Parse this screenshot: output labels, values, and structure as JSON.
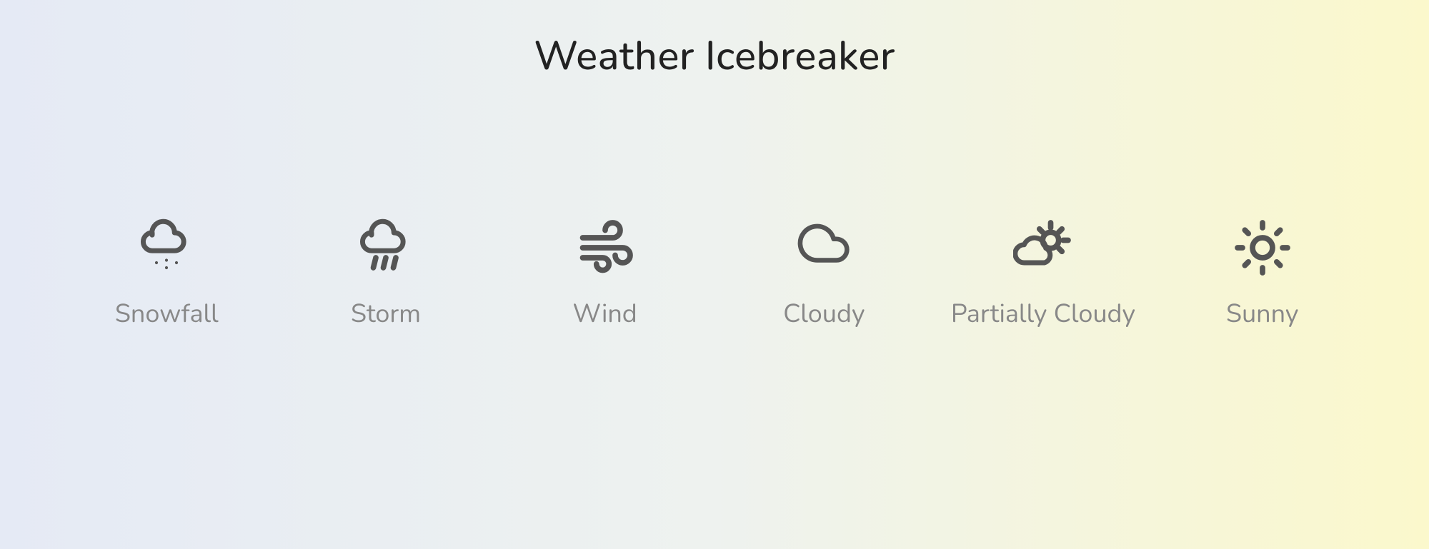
{
  "title": "Weather Icebreaker",
  "items": [
    {
      "label": "Snowfall",
      "icon": "snow-icon"
    },
    {
      "label": "Storm",
      "icon": "rain-icon"
    },
    {
      "label": "Wind",
      "icon": "wind-icon"
    },
    {
      "label": "Cloudy",
      "icon": "cloud-icon"
    },
    {
      "label": "Partially Cloudy",
      "icon": "partly-cloudy-icon"
    },
    {
      "label": "Sunny",
      "icon": "sun-icon"
    }
  ]
}
